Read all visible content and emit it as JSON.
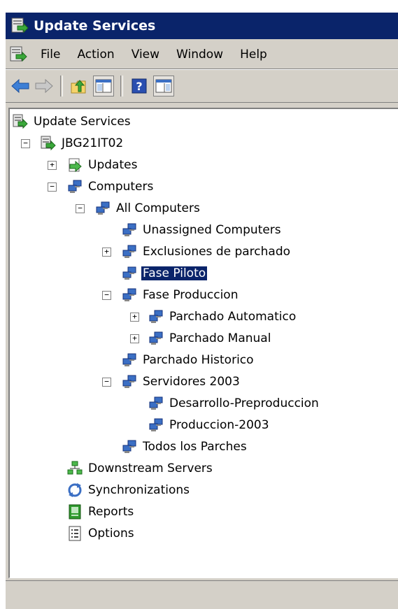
{
  "window": {
    "title": "Update Services"
  },
  "menu": [
    "File",
    "Action",
    "View",
    "Window",
    "Help"
  ],
  "toolbar": [
    "back-icon",
    "forward-icon",
    "up-folder-icon",
    "show-hide-tree-icon",
    "help-icon",
    "action-pane-icon"
  ],
  "tree": {
    "root": "Update Services",
    "server": "JBG21IT02",
    "updates": "Updates",
    "computers": "Computers",
    "all_computers": "All Computers",
    "unassigned": "Unassigned Computers",
    "exclusiones": "Exclusiones de parchado",
    "fase_piloto": "Fase Piloto",
    "fase_produccion": "Fase Produccion",
    "parchado_automatico": "Parchado Automatico",
    "parchado_manual": "Parchado Manual",
    "parchado_historico": "Parchado Historico",
    "servidores_2003": "Servidores 2003",
    "desarrollo": "Desarrollo-Preproduccion",
    "produccion_2003": "Produccion-2003",
    "todos": "Todos los Parches",
    "downstream": "Downstream Servers",
    "synchronizations": "Synchronizations",
    "reports": "Reports",
    "options": "Options"
  },
  "colors": {
    "titlebar": "#0a246a",
    "selection": "#0a246a",
    "chrome": "#d4d0c8"
  }
}
